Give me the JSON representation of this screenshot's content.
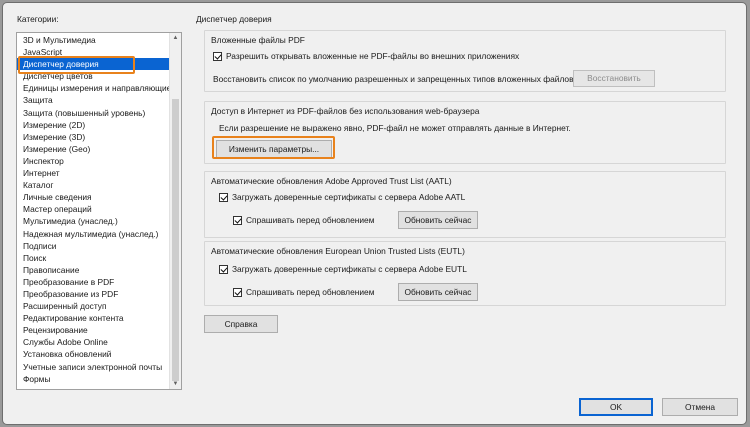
{
  "categories": {
    "label": "Категории:",
    "items": [
      "3D и Мультимедиа",
      "JavaScript",
      "Диспетчер доверия",
      "Диспетчер цветов",
      "Единицы измерения и направляющие",
      "Защита",
      "Защита (повышенный уровень)",
      "Измерение (2D)",
      "Измерение (3D)",
      "Измерение (Geo)",
      "Инспектор",
      "Интернет",
      "Каталог",
      "Личные сведения",
      "Мастер операций",
      "Мультимедиа (унаслед.)",
      "Надежная мультимедиа (унаслед.)",
      "Подписи",
      "Поиск",
      "Правописание",
      "Преобразование в PDF",
      "Преобразование из PDF",
      "Расширенный доступ",
      "Редактирование контента",
      "Рецензирование",
      "Службы Adobe Online",
      "Установка обновлений",
      "Учетные записи электронной почты",
      "Формы"
    ],
    "selected_index": 2,
    "scroll_up_glyph": "▲",
    "scroll_down_glyph": "▼"
  },
  "panel": {
    "title": "Диспетчер доверия",
    "attachments": {
      "title": "Вложенные файлы PDF",
      "allow_label": "Разрешить открывать вложенные не PDF-файлы во внешних приложениях",
      "allow_checked": true,
      "restore_text": "Восстановить список по умолчанию разрешенных и запрещенных типов вложенных файлов:",
      "restore_button": "Восстановить"
    },
    "internet": {
      "title": "Доступ в Интернет из PDF-файлов без использования web-браузера",
      "description": "Если разрешение не выражено явно, PDF-файл не может отправлять данные в Интернет.",
      "change_button": "Изменить параметры..."
    },
    "aatl": {
      "title": "Автоматические обновления Adobe Approved Trust List (AATL)",
      "load_label": "Загружать доверенные сертификаты с сервера Adobe AATL",
      "load_checked": true,
      "ask_label": "Спрашивать перед обновлением",
      "ask_checked": true,
      "update_button": "Обновить сейчас"
    },
    "eutl": {
      "title": "Автоматические обновления European Union Trusted Lists (EUTL)",
      "load_label": "Загружать доверенные сертификаты с сервера Adobe EUTL",
      "load_checked": true,
      "ask_label": "Спрашивать перед обновлением",
      "ask_checked": true,
      "update_button": "Обновить сейчас"
    },
    "help_button": "Справка"
  },
  "footer": {
    "ok_button": "OK",
    "cancel_button": "Отмена"
  },
  "colors": {
    "selection": "#0a64d2",
    "highlight": "#e8821c"
  }
}
